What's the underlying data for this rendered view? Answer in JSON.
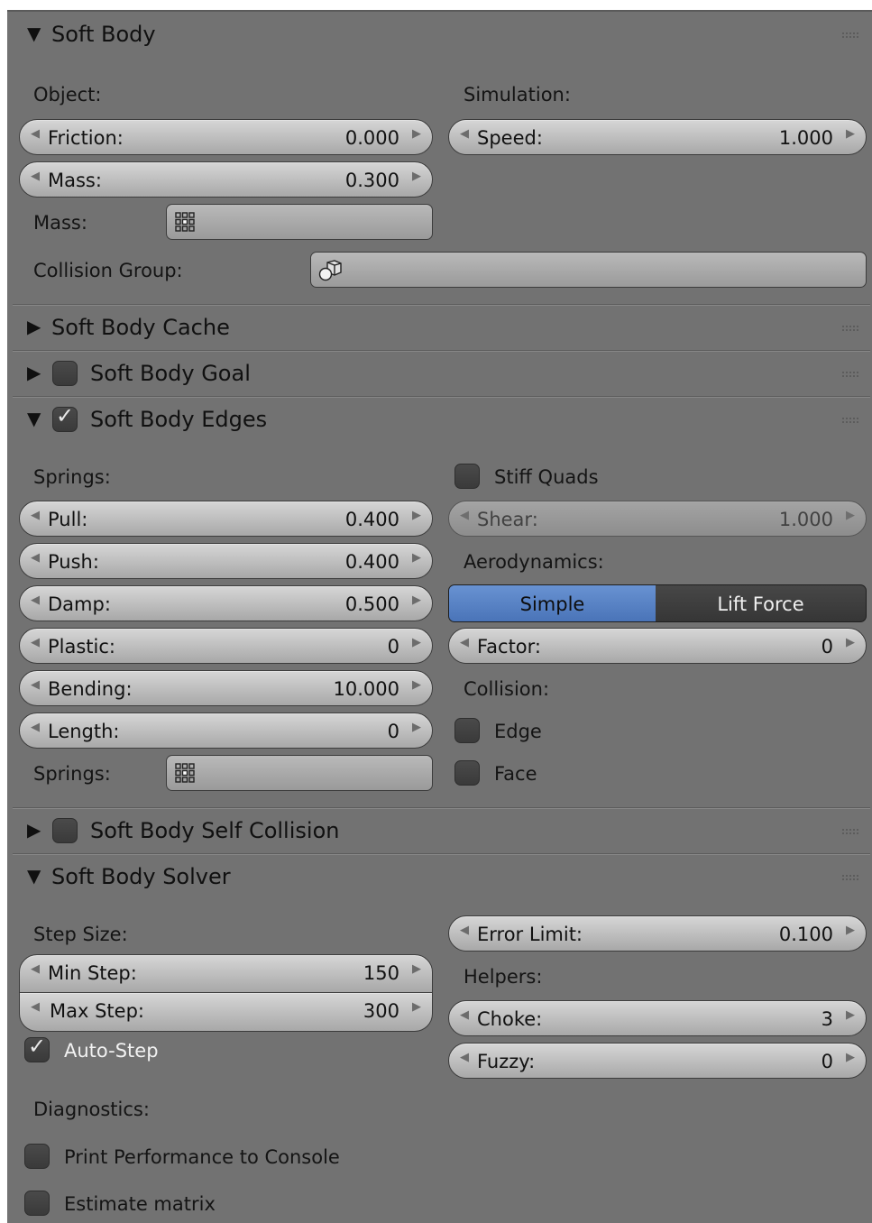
{
  "panels": {
    "soft_body": {
      "title": "Soft Body",
      "object_label": "Object:",
      "simulation_label": "Simulation:",
      "friction": {
        "label": "Friction:",
        "value": "0.000"
      },
      "mass": {
        "label": "Mass:",
        "value": "0.300"
      },
      "speed": {
        "label": "Speed:",
        "value": "1.000"
      },
      "mass_vgroup_label": "Mass:",
      "collision_group_label": "Collision Group:"
    },
    "cache": {
      "title": "Soft Body Cache"
    },
    "goal": {
      "title": "Soft Body Goal",
      "enabled": false
    },
    "edges": {
      "title": "Soft Body Edges",
      "enabled": true,
      "springs_label": "Springs:",
      "pull": {
        "label": "Pull:",
        "value": "0.400"
      },
      "push": {
        "label": "Push:",
        "value": "0.400"
      },
      "damp": {
        "label": "Damp:",
        "value": "0.500"
      },
      "plastic": {
        "label": "Plastic:",
        "value": "0"
      },
      "bending": {
        "label": "Bending:",
        "value": "10.000"
      },
      "length": {
        "label": "Length:",
        "value": "0"
      },
      "springs_vgroup_label": "Springs:",
      "stiff_quads": "Stiff Quads",
      "shear": {
        "label": "Shear:",
        "value": "1.000"
      },
      "aerodynamics_label": "Aerodynamics:",
      "aero_simple": "Simple",
      "aero_lift": "Lift Force",
      "factor": {
        "label": "Factor:",
        "value": "0"
      },
      "collision_label": "Collision:",
      "edge": "Edge",
      "face": "Face"
    },
    "self_collision": {
      "title": "Soft Body Self Collision",
      "enabled": false
    },
    "solver": {
      "title": "Soft Body Solver",
      "step_size_label": "Step Size:",
      "min_step": {
        "label": "Min Step:",
        "value": "150"
      },
      "max_step": {
        "label": "Max Step:",
        "value": "300"
      },
      "auto_step": "Auto-Step",
      "error_limit": {
        "label": "Error Limit:",
        "value": "0.100"
      },
      "helpers_label": "Helpers:",
      "choke": {
        "label": "Choke:",
        "value": "3"
      },
      "fuzzy": {
        "label": "Fuzzy:",
        "value": "0"
      },
      "diagnostics_label": "Diagnostics:",
      "print_performance": "Print Performance to Console",
      "estimate_matrix": "Estimate matrix"
    }
  },
  "colors": {
    "panel_bg": "#727272",
    "accent_active": "#5680c2",
    "segment_inactive": "#3d3d3d"
  }
}
